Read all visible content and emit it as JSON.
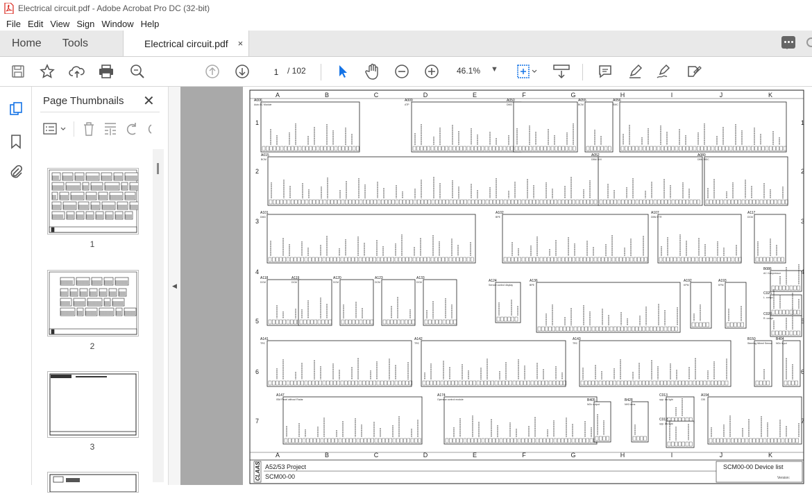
{
  "window": {
    "title": "Electrical circuit.pdf - Adobe Acrobat Pro DC (32-bit)"
  },
  "menu": [
    "File",
    "Edit",
    "View",
    "Sign",
    "Window",
    "Help"
  ],
  "tabs": {
    "home": "Home",
    "tools": "Tools",
    "document": "Electrical circuit.pdf",
    "close": "×"
  },
  "toolbar": {
    "page_current": "1",
    "page_total": "/ 102",
    "zoom": "46.1%",
    "zoom_arrow": "▼"
  },
  "panel": {
    "title": "Page Thumbnails",
    "close": "✕",
    "thumbnails": [
      {
        "label": "1"
      },
      {
        "label": "2"
      },
      {
        "label": "3"
      }
    ]
  },
  "document": {
    "columns": [
      "A",
      "B",
      "C",
      "D",
      "E",
      "F",
      "G",
      "H",
      "I",
      "J",
      "K"
    ],
    "rows": [
      "1",
      "2",
      "3",
      "4",
      "5",
      "6",
      "7"
    ],
    "title_block": {
      "logo": "CLAAS",
      "project": "A52/53 Project",
      "code": "SCM00-00",
      "device_list": "SCM00-00 Device list",
      "version": "Version:"
    },
    "modules": [
      {
        "id": "A006",
        "label": "Auto AC Module"
      },
      {
        "id": "A009",
        "label": "ATP"
      },
      {
        "id": "A050",
        "label": "DMD"
      },
      {
        "id": "A055",
        "label": "BCM"
      },
      {
        "id": "A056",
        "label": "SMC"
      },
      {
        "id": "A015",
        "label": "BCM"
      },
      {
        "id": "A052",
        "label": "DBM SHI"
      },
      {
        "id": "A080",
        "label": "DBM MDC"
      },
      {
        "id": "A101",
        "label": "DMD"
      },
      {
        "id": "A102",
        "label": "BPE"
      },
      {
        "id": "A107",
        "label": "DBM FTR"
      },
      {
        "id": "A117",
        "label": "DCM"
      },
      {
        "id": "A118",
        "label": "DCM"
      },
      {
        "id": "A119",
        "label": "DCM"
      },
      {
        "id": "A120",
        "label": "DCM"
      },
      {
        "id": "A123",
        "label": "DCM"
      },
      {
        "id": "A133",
        "label": "DCM"
      },
      {
        "id": "A124",
        "label": "Service control display"
      },
      {
        "id": "A136",
        "label": "BPE"
      },
      {
        "id": "A192",
        "label": "KPM"
      },
      {
        "id": "A193",
        "label": "KPM"
      },
      {
        "id": "A141",
        "label": "TRC"
      },
      {
        "id": "A142",
        "label": "TRC"
      },
      {
        "id": "A143",
        "label": "TRC"
      },
      {
        "id": "B150",
        "label": "Steering Wheel Sensor"
      },
      {
        "id": "B404",
        "label": "NOx input"
      },
      {
        "id": "A147",
        "label": "ISM Panel without Radar"
      },
      {
        "id": "A174",
        "label": "Operator control module"
      },
      {
        "id": "B405",
        "label": "NOx output"
      },
      {
        "id": "B428",
        "label": "NH3 sens"
      },
      {
        "id": "C013",
        "label": "upp. dis light"
      },
      {
        "id": "C012",
        "label": "upp. dis light"
      },
      {
        "id": "A194",
        "label": "CIB"
      },
      {
        "id": "B086",
        "label": "AC Compressor"
      },
      {
        "id": "C025",
        "label": "L. compr."
      },
      {
        "id": "C026",
        "label": "R. compr."
      }
    ]
  },
  "colors": {
    "accent": "#d9261c",
    "toolbar_bg": "#ffffff",
    "tab_bg": "#e9e9e9",
    "doc_bg": "#a9a9a9",
    "selected_icon": "#1473e6"
  }
}
